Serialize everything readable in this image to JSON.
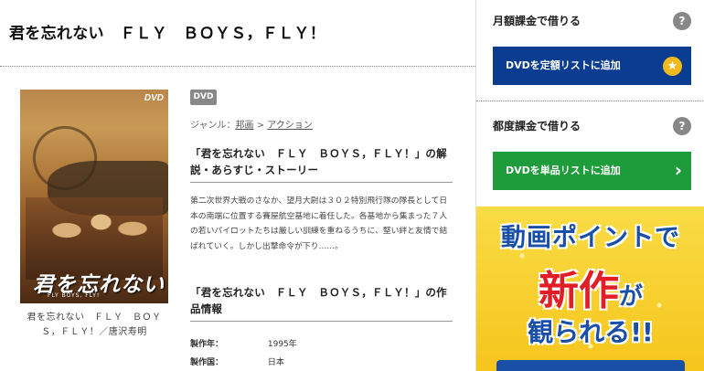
{
  "page": {
    "title": "君を忘れない　ＦＬＹ　ＢＯＹＳ，ＦＬＹ！"
  },
  "poster": {
    "dvd_logo": "DVD",
    "title_art": "君を忘れない",
    "subtitle_art": "FLY BOYS, FLY!",
    "caption": "君を忘れない　ＦＬＹ　ＢＯＹＳ，ＦＬＹ！／唐沢寿明"
  },
  "info": {
    "format_badge": "DVD",
    "genre_label": "ジャンル：",
    "genre_main": "邦画",
    "genre_separator": ">",
    "genre_sub": "アクション",
    "synopsis_heading": "「君を忘れない　ＦＬＹ　ＢＯＹＳ，ＦＬＹ！」の解説・あらすじ・ストーリー",
    "synopsis": "第二次世界大戦のさなか、望月大尉は３０２特別飛行隊の隊長として日本の南端に位置する賽屋航空基地に着任した。各基地から集まった７人の若いパイロットたちは厳しい訓練を重ねるうちに、堅い絆と友情で結ばれていく。しかし出撃命令が下り……。",
    "details_heading": "「君を忘れない　ＦＬＹ　ＢＯＹＳ，ＦＬＹ！」の作品情報",
    "rows": [
      {
        "label": "製作年：",
        "value": "1995年"
      },
      {
        "label": "製作国：",
        "value": "日本"
      }
    ]
  },
  "sidebar": {
    "monthly": {
      "label": "月額課金で借りる",
      "help": "?",
      "button": "DVDを定額リストに追加",
      "button_icon": "star-icon",
      "button_color": "#0a3d91"
    },
    "single": {
      "label": "都度課金で借りる",
      "help": "?",
      "button": "DVDを単品リストに追加",
      "button_icon": "chevron-right-icon",
      "button_color": "#1e9b3a"
    },
    "promo": {
      "line1": "動画ポイントで",
      "line2_big": "新作",
      "line2_small": "が",
      "line3": "観られる!!"
    }
  }
}
